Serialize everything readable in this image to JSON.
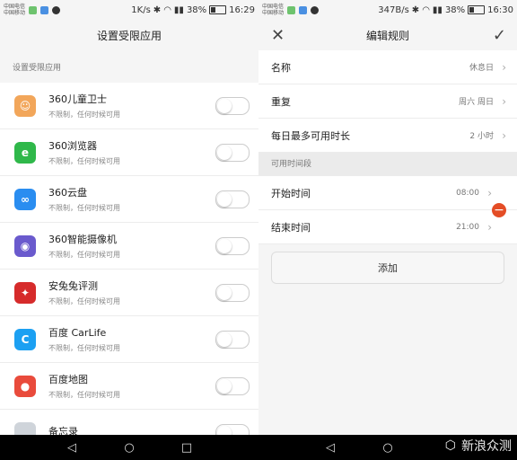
{
  "left": {
    "status": {
      "carrier1": "中国电信",
      "carrier2": "中国移动",
      "speed": "1K/s",
      "battery": "38%",
      "time": "16:29"
    },
    "title": "设置受限应用",
    "section": "设置受限应用",
    "apps": [
      {
        "name": "360儿童卫士",
        "sub": "不限制，任何时候可用",
        "icon": "child-guard-icon",
        "color": "#f2a65a",
        "glyph": "☺"
      },
      {
        "name": "360浏览器",
        "sub": "不限制，任何时候可用",
        "icon": "browser-icon",
        "color": "#2fb84a",
        "glyph": "e"
      },
      {
        "name": "360云盘",
        "sub": "不限制，任何时候可用",
        "icon": "cloud-drive-icon",
        "color": "#2a8df0",
        "glyph": "∞"
      },
      {
        "name": "360智能摄像机",
        "sub": "不限制，任何时候可用",
        "icon": "camera-icon",
        "color": "#6a5acd",
        "glyph": "◉"
      },
      {
        "name": "安兔兔评测",
        "sub": "不限制，任何时候可用",
        "icon": "antutu-icon",
        "color": "#d62b2b",
        "glyph": "✦"
      },
      {
        "name": "百度 CarLife",
        "sub": "不限制，任何时候可用",
        "icon": "carlife-icon",
        "color": "#1ca0f2",
        "glyph": "C"
      },
      {
        "name": "百度地图",
        "sub": "不限制，任何时候可用",
        "icon": "map-icon",
        "color": "#e94b3c",
        "glyph": "●"
      },
      {
        "name": "备忘录",
        "sub": "",
        "icon": "memo-icon",
        "color": "#cfd4da",
        "glyph": ""
      }
    ]
  },
  "right": {
    "status": {
      "carrier1": "中国电信",
      "carrier2": "中国移动",
      "speed": "347B/s",
      "battery": "38%",
      "time": "16:30"
    },
    "title": "编辑规则",
    "rows": [
      {
        "label": "名称",
        "value": "休息日"
      },
      {
        "label": "重复",
        "value": "周六 周日"
      },
      {
        "label": "每日最多可用时长",
        "value": "2 小时"
      }
    ],
    "group": "可用时间段",
    "times": [
      {
        "label": "开始时间",
        "value": "08:00"
      },
      {
        "label": "结束时间",
        "value": "21:00"
      }
    ],
    "add": "添加"
  },
  "watermark": "新浪众测"
}
